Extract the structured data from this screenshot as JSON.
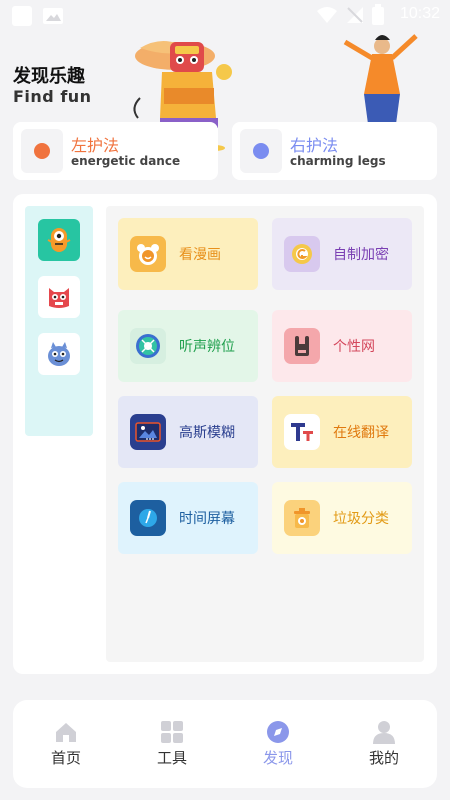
{
  "status_bar": {
    "time": "10:32"
  },
  "header": {
    "title": "发现乐趣",
    "subtitle": "Find fun"
  },
  "guard_cards": [
    {
      "title": "左护法",
      "subtitle": "energetic dance",
      "color": "#f0733e"
    },
    {
      "title": "右护法",
      "subtitle": "charming legs",
      "color": "#7a8cf0"
    }
  ],
  "sidebar": {
    "items": [
      {
        "icon": "orange-monster-icon",
        "bg": "#27c5a2"
      },
      {
        "icon": "red-monster-icon",
        "bg": "#ffffff"
      },
      {
        "icon": "blue-monster-icon",
        "bg": "#ffffff"
      }
    ]
  },
  "tools": [
    {
      "label": "看漫画",
      "icon": "bear-icon",
      "bg": "#fdefbd",
      "color": "#e8901c"
    },
    {
      "label": "自制加密",
      "icon": "encrypt-icon",
      "bg": "#ece8f6",
      "color": "#7a3fb3"
    },
    {
      "label": "听声辨位",
      "icon": "compass-icon",
      "bg": "#e3f6e8",
      "color": "#1e9f4c"
    },
    {
      "label": "个性网",
      "icon": "rock-hand-icon",
      "bg": "#fde8eb",
      "color": "#d4475c"
    },
    {
      "label": "高斯模糊",
      "icon": "image-icon",
      "bg": "#e4e7f6",
      "color": "#2a3f8f"
    },
    {
      "label": "在线翻译",
      "icon": "translate-icon",
      "bg": "#fdefbd",
      "color": "#e07a10"
    },
    {
      "label": "时间屏幕",
      "icon": "clock-icon",
      "bg": "#dff3fd",
      "color": "#1d5fa0"
    },
    {
      "label": "垃圾分类",
      "icon": "trash-icon",
      "bg": "#fefae1",
      "color": "#e29a16"
    }
  ],
  "bottom_nav": {
    "items": [
      {
        "label": "首页",
        "icon": "home-icon",
        "active": false
      },
      {
        "label": "工具",
        "icon": "grid-icon",
        "active": false
      },
      {
        "label": "发现",
        "icon": "compass-icon",
        "active": true
      },
      {
        "label": "我的",
        "icon": "user-icon",
        "active": false
      }
    ],
    "active_color": "#8b97ea",
    "inactive_color": "#d0d0d6"
  }
}
